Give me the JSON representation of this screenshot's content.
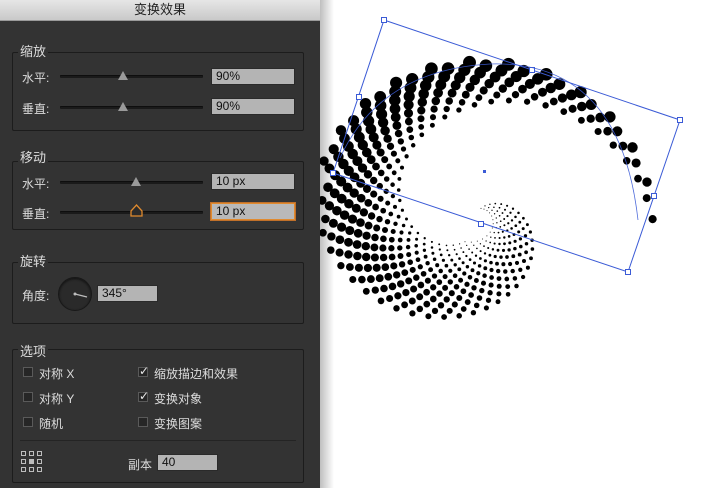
{
  "dialog": {
    "title": "变换效果"
  },
  "scale": {
    "title": "缩放",
    "horizontal_label": "水平:",
    "horizontal_value": "90%",
    "horizontal_slider": 0.45,
    "vertical_label": "垂直:",
    "vertical_value": "90%",
    "vertical_slider": 0.45
  },
  "move": {
    "title": "移动",
    "horizontal_label": "水平:",
    "horizontal_value": "10 px",
    "horizontal_slider": 0.5,
    "vertical_label": "垂直:",
    "vertical_value": "10 px",
    "vertical_slider": 0.5
  },
  "rotate": {
    "title": "旋转",
    "angle_label": "角度:",
    "angle_value": "345°"
  },
  "options": {
    "title": "选项",
    "reflect_x": {
      "label": "对称 X",
      "checked": false
    },
    "reflect_y": {
      "label": "对称 Y",
      "checked": false
    },
    "random": {
      "label": "随机",
      "checked": false
    },
    "scale_strokes": {
      "label": "缩放描边和效果",
      "checked": true
    },
    "transform_objects": {
      "label": "变换对象",
      "checked": true
    },
    "transform_patterns": {
      "label": "变换图案",
      "checked": false
    },
    "copies_label": "副本",
    "copies_value": "40"
  },
  "colors": {
    "panel_bg": "#333333",
    "accent_focus": "#e08a2e",
    "selection_blue": "#3b5bd6"
  },
  "icons": {
    "reference_point": "reference-point-grid-icon",
    "angle_dial": "angle-dial-icon",
    "checkmark": "checkmark-icon"
  }
}
